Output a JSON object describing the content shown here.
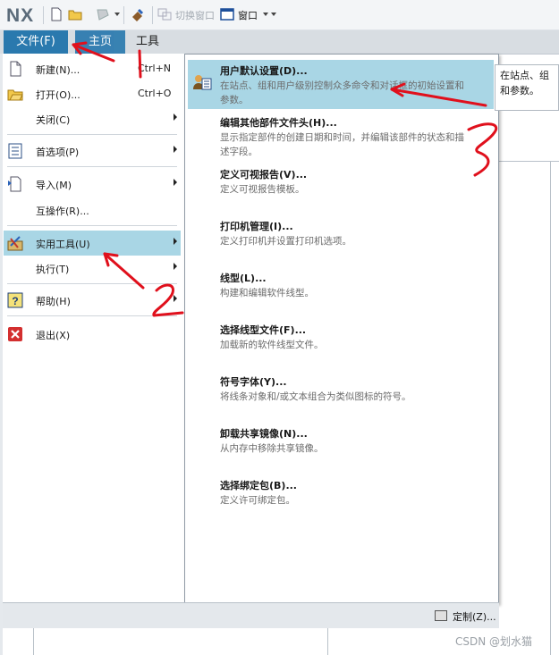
{
  "qat": {
    "logo": "NX",
    "switch_window": "切换窗口",
    "window": "窗口"
  },
  "tabs": {
    "file": "文件(F)",
    "home": "主页",
    "tools": "工具"
  },
  "file_menu": [
    {
      "label": "新建(N)...",
      "shortcut": "Ctrl+N"
    },
    {
      "label": "打开(O)...",
      "shortcut": "Ctrl+O"
    },
    {
      "label": "关闭(C)"
    },
    {
      "label": "首选项(P)"
    },
    {
      "label": "导入(M)"
    },
    {
      "label": "互操作(R)..."
    },
    {
      "label": "实用工具(U)"
    },
    {
      "label": "执行(T)"
    },
    {
      "label": "帮助(H)"
    },
    {
      "label": "退出(X)"
    }
  ],
  "submenu": [
    {
      "title": "用户默认设置(D)...",
      "desc1": "在站点、组和用户级别控制众多命令和对话框的初始设置和",
      "desc2": "参数。"
    },
    {
      "title": "编辑其他部件文件头(H)...",
      "desc1": "显示指定部件的创建日期和时间，并编辑该部件的状态和描",
      "desc2": "述字段。"
    },
    {
      "title": "定义可视报告(V)...",
      "desc1": "定义可视报告模板。"
    },
    {
      "title": "打印机管理(I)...",
      "desc1": "定义打印机并设置打印机选项。"
    },
    {
      "title": "线型(L)...",
      "desc1": "构建和编辑软件线型。"
    },
    {
      "title": "选择线型文件(F)...",
      "desc1": "加载新的软件线型文件。"
    },
    {
      "title": "符号字体(Y)...",
      "desc1": "将线条对象和/或文本组合为类似图标的符号。"
    },
    {
      "title": "卸载共享镜像(N)...",
      "desc1": "从内存中移除共享镜像。"
    },
    {
      "title": "选择绑定包(B)...",
      "desc1": "定义许可绑定包。"
    }
  ],
  "tooltip": {
    "line1": "在站点、组",
    "line2": "和参数。"
  },
  "customize_label": "定制(Z)...",
  "watermark": "CSDN @划水猫",
  "colors": {
    "accent": "#2a79ae",
    "highlight": "#a9d6e5",
    "annotation": "#e0101c"
  }
}
